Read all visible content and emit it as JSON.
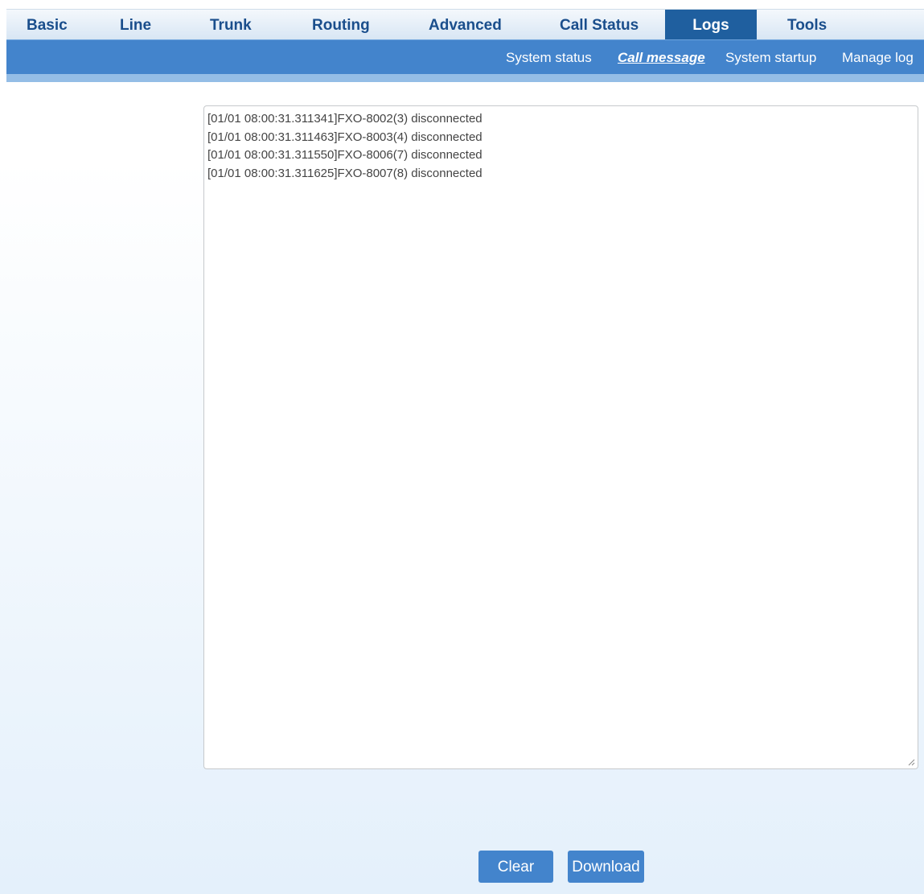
{
  "nav": {
    "tabs": [
      {
        "label": "Basic"
      },
      {
        "label": "Line"
      },
      {
        "label": "Trunk"
      },
      {
        "label": "Routing"
      },
      {
        "label": "Advanced"
      },
      {
        "label": "Call Status"
      },
      {
        "label": "Logs"
      },
      {
        "label": "Tools"
      }
    ],
    "active_tab": "Logs"
  },
  "subnav": {
    "items": [
      {
        "label": "System status"
      },
      {
        "label": "Call message"
      },
      {
        "label": "System startup"
      },
      {
        "label": "Manage log"
      }
    ],
    "active_item": "Call message"
  },
  "log": {
    "lines": [
      "[01/01 08:00:31.311341]FXO-8002(3) disconnected",
      "[01/01 08:00:31.311463]FXO-8003(4) disconnected",
      "[01/01 08:00:31.311550]FXO-8006(7) disconnected",
      "[01/01 08:00:31.311625]FXO-8007(8) disconnected"
    ]
  },
  "actions": {
    "clear_label": "Clear",
    "download_label": "Download"
  },
  "colors": {
    "nav_active": "#1f5f9f",
    "subnav_bg": "#4384cc",
    "button_bg": "#4384cc"
  }
}
